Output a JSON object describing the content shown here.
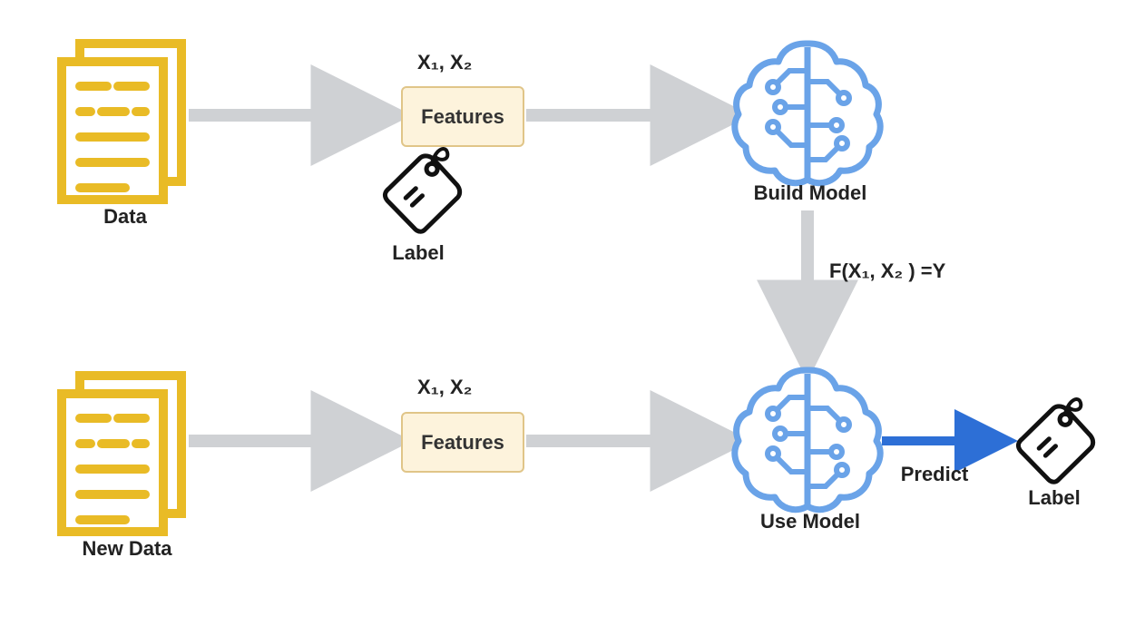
{
  "nodes": {
    "data": {
      "label": "Data"
    },
    "newData": {
      "label": "New Data"
    },
    "features1": {
      "label": "Features",
      "vars": "X₁, X₂"
    },
    "features2": {
      "label": "Features",
      "vars": "X₁, X₂"
    },
    "labelTag1": {
      "label": "Label"
    },
    "labelTag2": {
      "label": "Label"
    },
    "buildModel": {
      "label": "Build Model"
    },
    "useModel": {
      "label": "Use Model"
    }
  },
  "edges": {
    "modelFormula": "F(X₁, X₂ ) =Y",
    "predict": "Predict"
  },
  "colors": {
    "dataIcon": "#e9bb26",
    "arrowGray": "#cfd1d4",
    "arrowBlue": "#2d6fd6",
    "brainBlue": "#6aa3e8",
    "boxBorder": "#e0c588",
    "boxFill": "#fdf3dc",
    "tagStroke": "#111"
  }
}
